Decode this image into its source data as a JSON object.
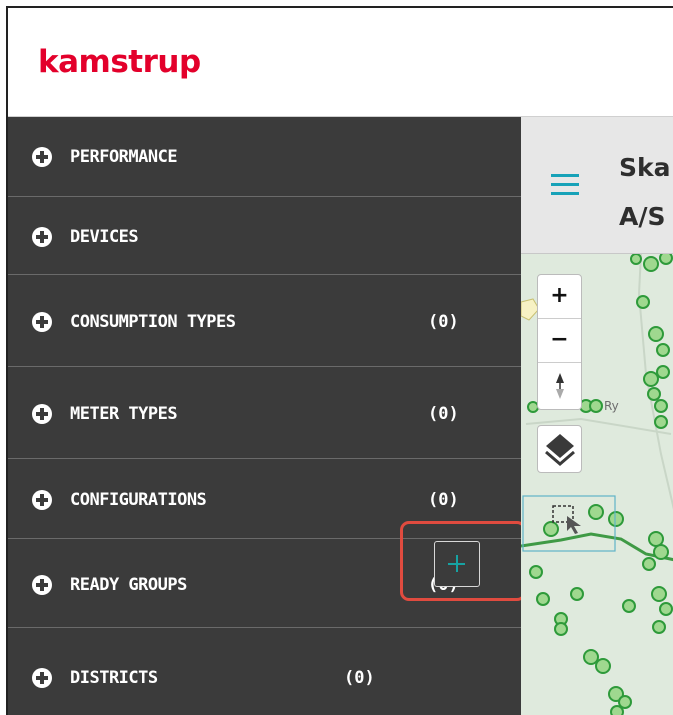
{
  "brand": {
    "logo_text": "kamstrup",
    "logo_color": "#e3002b"
  },
  "sidebar": {
    "items": [
      {
        "label": "PERFORMANCE",
        "count": ""
      },
      {
        "label": "DEVICES",
        "count": ""
      },
      {
        "label": "CONSUMPTION TYPES",
        "count": "(0)"
      },
      {
        "label": "METER TYPES",
        "count": "(0)"
      },
      {
        "label": "CONFIGURATIONS",
        "count": "(0)"
      },
      {
        "label": "READY GROUPS",
        "count": "(0)"
      },
      {
        "label": "DISTRICTS",
        "count": "(0)"
      }
    ],
    "add_icon": "plus-icon"
  },
  "main": {
    "title_lines": [
      "Ska",
      "A/S"
    ],
    "menu_icon": "hamburger-icon"
  },
  "map": {
    "controls": {
      "zoom_in": "+",
      "zoom_out": "−",
      "compass_icon": "compass-icon",
      "layers_icon": "layers-icon",
      "select_icon": "box-select-icon"
    },
    "label_partial": "Ry"
  },
  "colors": {
    "sidebar_bg": "#3b3b3b",
    "accent": "#17a2a2",
    "highlight": "#e04b3f",
    "map_bg": "#dfeadd",
    "marker": "#4caf3a"
  }
}
